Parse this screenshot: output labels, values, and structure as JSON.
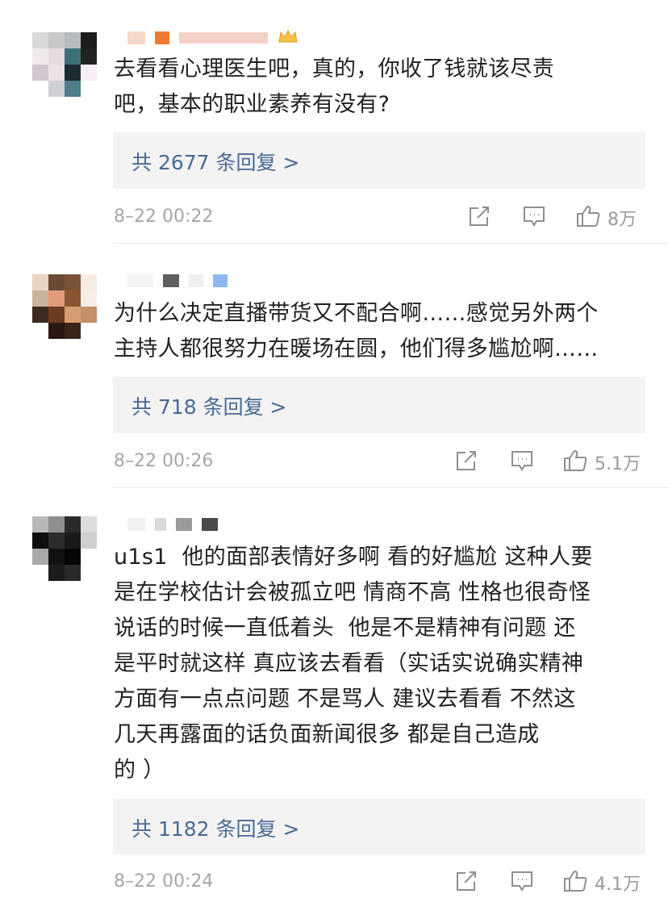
{
  "comments": [
    {
      "text": "去看看心理医生吧，真的，你收了钱就该尽责\n吧，基本的职业素养有没有?",
      "replies_label": "共 2677 条回复 >",
      "time": "8–22 00:22",
      "likes": "8万"
    },
    {
      "text": "为什么决定直播带货又不配合啊……感觉另外两个\n主持人都很努力在暖场在圆，他们得多尴尬啊……",
      "replies_label": "共 718 条回复 >",
      "time": "8–22 00:26",
      "likes": "5.1万"
    },
    {
      "text": "u1s1  他的面部表情好多啊 看的好尴尬 这种人要\n是在学校估计会被孤立吧 情商不高 性格也很奇怪\n说话的时候一直低着头  他是不是精神有问题 还\n是平时就这样 真应该去看看（实话实说确实精神\n方面有一点点问题 不是骂人 建议去看看 不然这\n几天再露面的话负面新闻很多 都是自己造成\n的 ）",
      "replies_label": "共 1182 条回复 >",
      "time": "8–22 00:24",
      "likes": "4.1万"
    }
  ],
  "icons": {
    "share": "share-icon",
    "comment": "comment-icon",
    "like": "thumbs-up-icon",
    "badge": "crown-badge-icon"
  },
  "colors": {
    "link": "#4a6a94",
    "meta": "#a6a6a6",
    "reply_bg": "#f3f3f3"
  }
}
